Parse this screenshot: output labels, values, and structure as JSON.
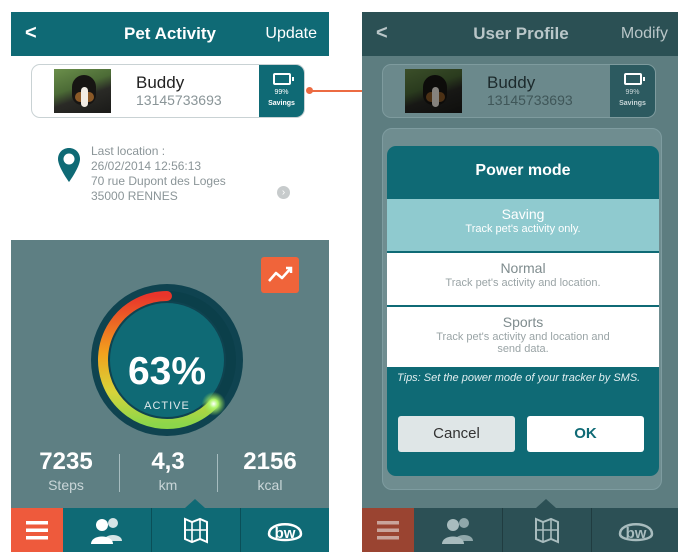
{
  "colors": {
    "teal": "#0f6a75",
    "orange": "#f0643a",
    "slate": "#5e7f83",
    "saving_highlight": "#8fcacf"
  },
  "activity_screen": {
    "header": {
      "back": "<",
      "title": "Pet Activity",
      "action": "Update"
    },
    "pet": {
      "name": "Buddy",
      "phone": "13145733693"
    },
    "power_badge": {
      "icon": "battery-icon",
      "percent": "99%",
      "mode": "Savings"
    },
    "location": {
      "label": "Last location :",
      "datetime": "26/02/2014 12:56:13",
      "street": "70 rue Dupont des Loges",
      "city": "35000 RENNES"
    },
    "activity": {
      "percent_value": 63,
      "percent_text": "63%",
      "label": "ACTIVE"
    },
    "stats": [
      {
        "value": "7235",
        "unit": "Steps"
      },
      {
        "value": "4,3",
        "unit": "km"
      },
      {
        "value": "2156",
        "unit": "kcal"
      }
    ],
    "tabs": [
      "menu-icon",
      "friends-icon",
      "map-icon",
      "bw-logo-icon"
    ]
  },
  "profile_screen": {
    "header": {
      "back": "<",
      "title": "User Profile",
      "action": "Modify"
    },
    "pet": {
      "name": "Buddy",
      "phone": "13145733693"
    },
    "power_badge": {
      "percent": "99%",
      "mode": "Savings"
    },
    "modal": {
      "title": "Power mode",
      "options": [
        {
          "name": "Saving",
          "desc": "Track pet's activity only.",
          "selected": true
        },
        {
          "name": "Normal",
          "desc": "Track pet's activity and location.",
          "selected": false
        },
        {
          "name": "Sports",
          "desc": "Track pet's activity and location and send data.",
          "selected": false
        }
      ],
      "tips": "Tips: Set the power mode of your tracker by SMS.",
      "cancel": "Cancel",
      "ok": "OK"
    },
    "tabs": [
      "menu-icon",
      "friends-icon",
      "map-icon",
      "bw-logo-icon"
    ]
  }
}
